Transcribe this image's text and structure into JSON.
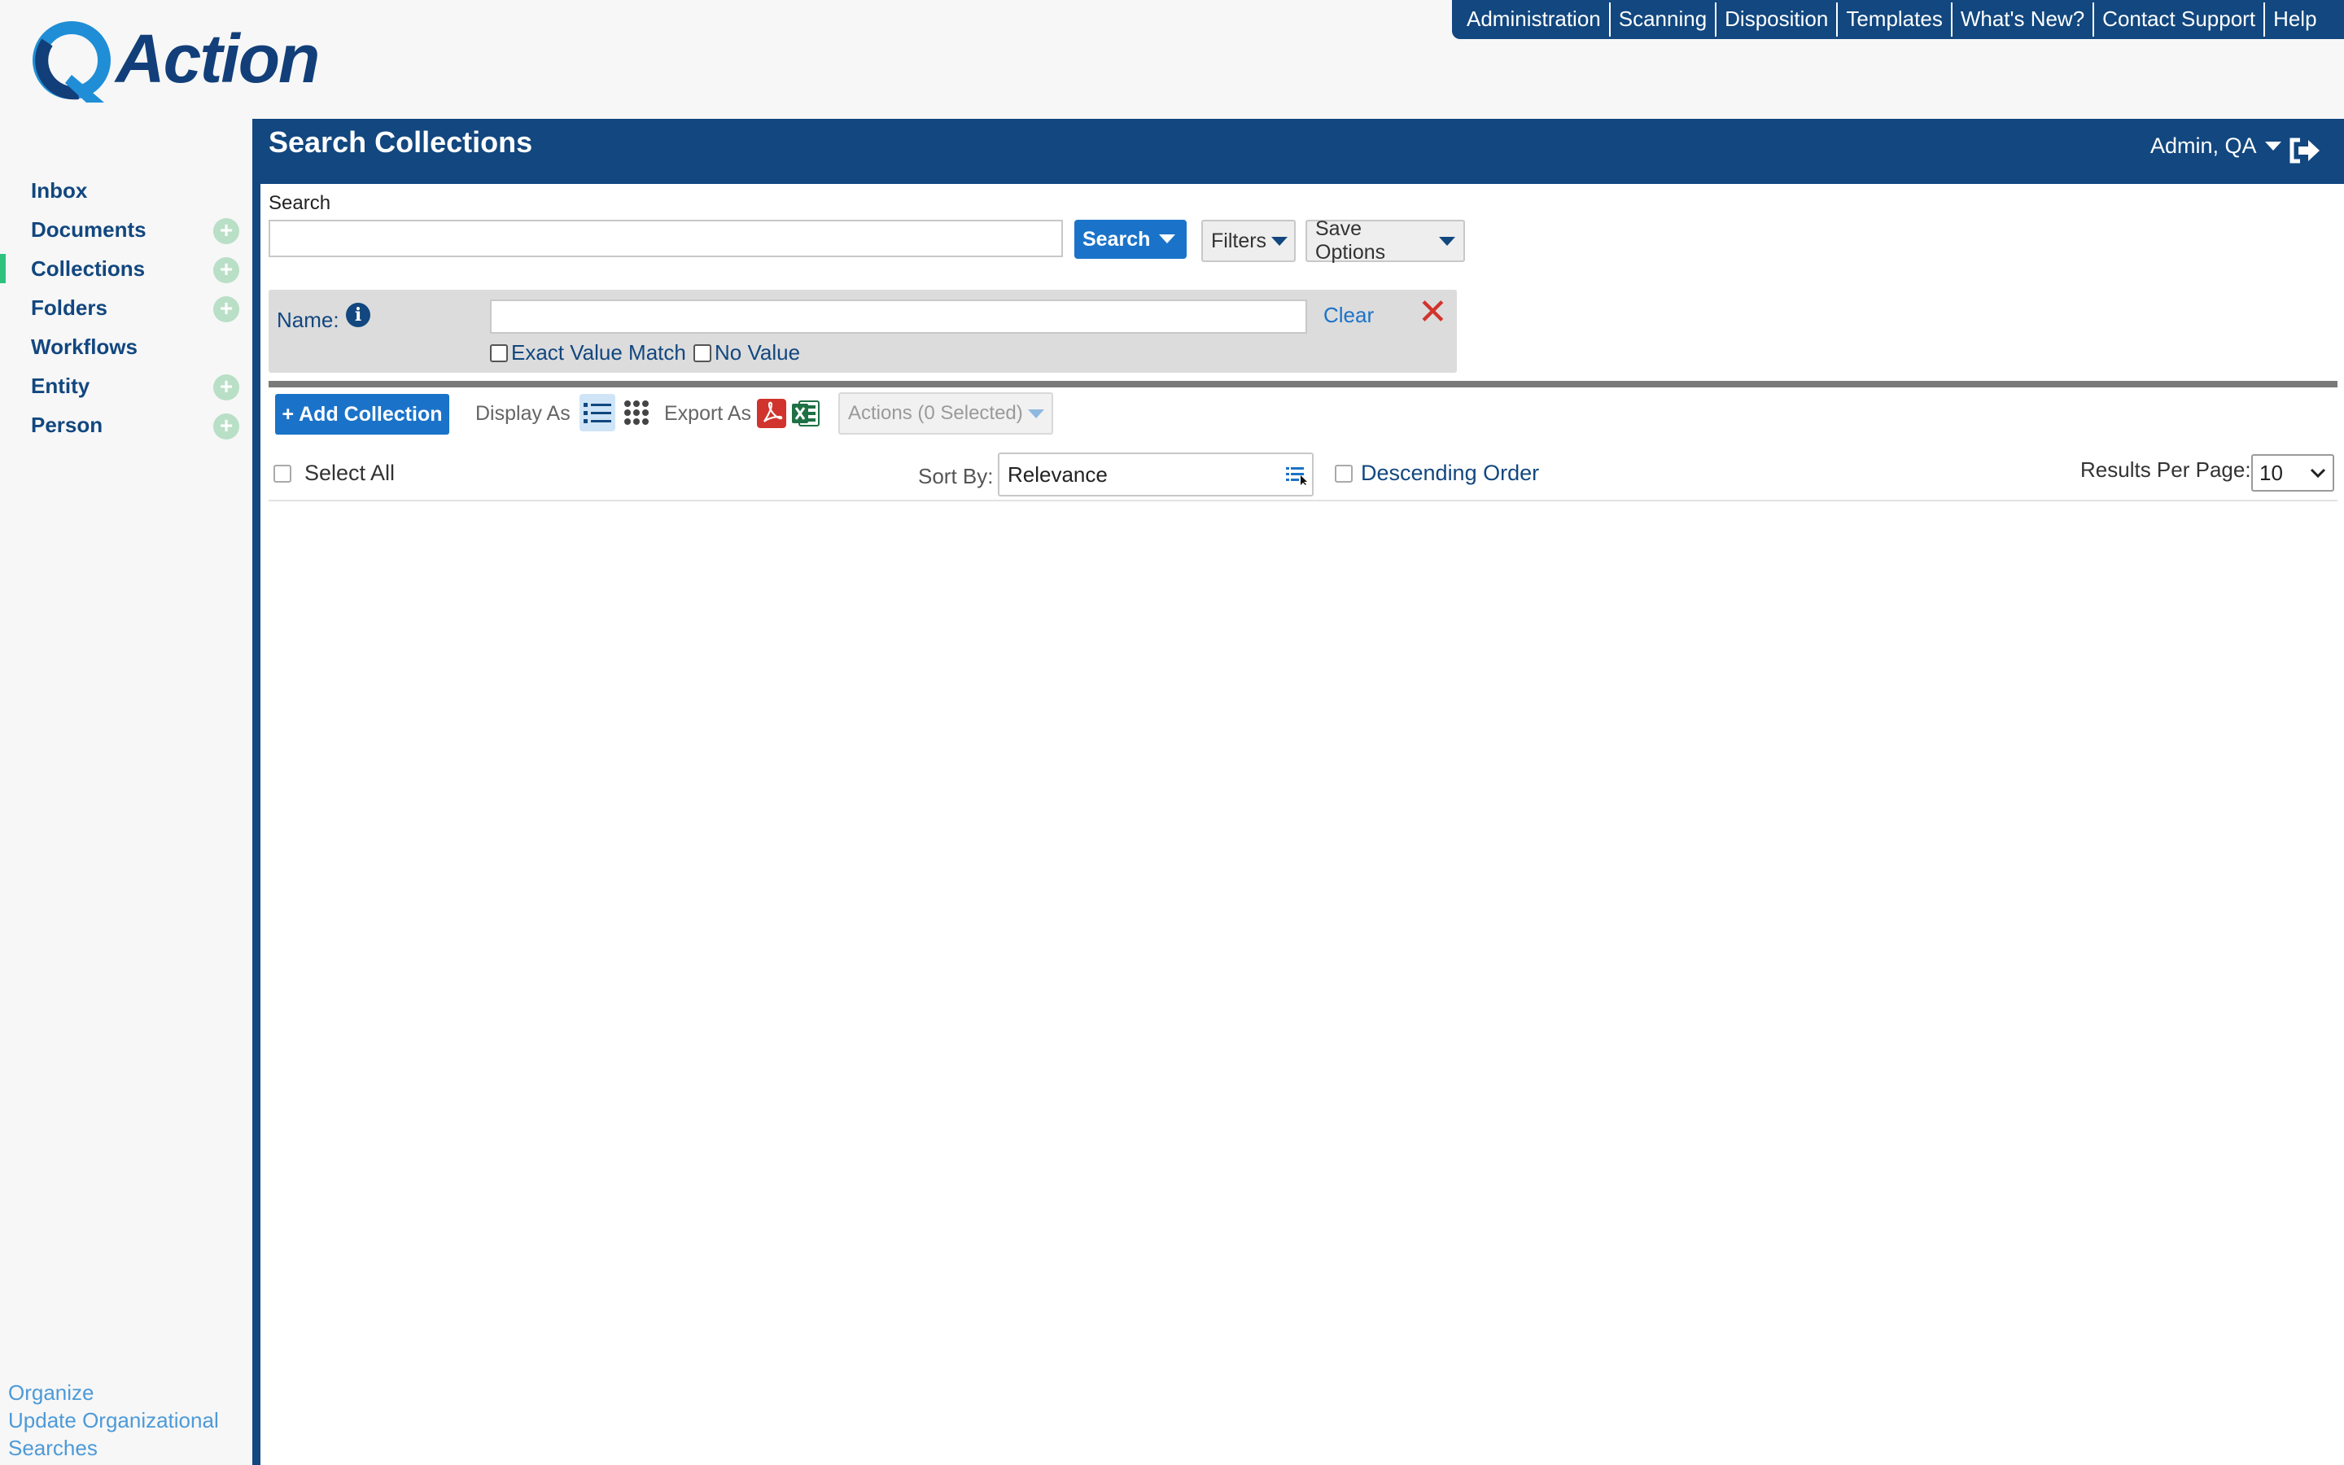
{
  "app": {
    "logo_text": "Action",
    "brand_color": "#12477f",
    "accent_color": "#1a73c9",
    "active_marker_color": "#2ec27e"
  },
  "topnav": {
    "items": [
      "Administration",
      "Scanning",
      "Disposition",
      "Templates",
      "What's New?",
      "Contact Support",
      "Help"
    ]
  },
  "sidebar": {
    "items": [
      {
        "label": "Inbox",
        "has_add": false,
        "active": false
      },
      {
        "label": "Documents",
        "has_add": true,
        "active": false
      },
      {
        "label": "Collections",
        "has_add": true,
        "active": true
      },
      {
        "label": "Folders",
        "has_add": true,
        "active": false
      },
      {
        "label": "Workflows",
        "has_add": false,
        "active": false
      },
      {
        "label": "Entity",
        "has_add": true,
        "active": false
      },
      {
        "label": "Person",
        "has_add": true,
        "active": false
      }
    ],
    "footer_links": [
      "Organize",
      "Update Organizational",
      "Searches"
    ]
  },
  "header": {
    "title": "Search Collections",
    "user": "Admin, QA"
  },
  "search": {
    "label": "Search",
    "value": "",
    "button": "Search",
    "filters": "Filters",
    "save_options": "Save Options"
  },
  "filter": {
    "name_label": "Name:",
    "value": "",
    "clear": "Clear",
    "exact_match": "Exact Value Match",
    "no_value": "No Value"
  },
  "toolbar": {
    "add_collection": "+ Add Collection",
    "display_as": "Display As",
    "export_as": "Export As",
    "actions": "Actions (0 Selected)"
  },
  "results": {
    "select_all": "Select All",
    "sort_by_label": "Sort By:",
    "sort_by_value": "Relevance",
    "descending_order": "Descending Order",
    "results_per_page_label": "Results Per Page:",
    "results_per_page_value": "10"
  }
}
